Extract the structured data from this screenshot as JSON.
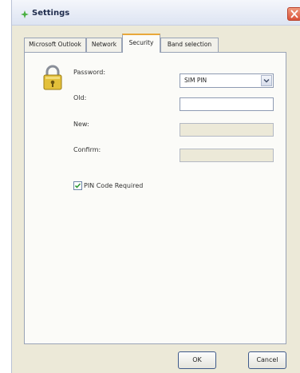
{
  "window": {
    "title": "Settings"
  },
  "tabs": [
    {
      "label": "Microsoft Outlook"
    },
    {
      "label": "Network"
    },
    {
      "label": "Security",
      "active": true
    },
    {
      "label": "Band selection"
    }
  ],
  "security": {
    "password_label": "Password:",
    "password_select_value": "SIM PIN",
    "old_label": "Old:",
    "old_value": "",
    "new_label": "New:",
    "confirm_label": "Confirm:",
    "pin_required_label": "PIN Code Required",
    "pin_required_checked": true
  },
  "buttons": {
    "ok": "OK",
    "cancel": "Cancel"
  },
  "colors": {
    "active_tab_accent": "#e9a83a",
    "close_button": "#d9533a",
    "title_icon": "#4ab043"
  },
  "icons": {
    "title": "settings-icon",
    "lock": "lock-icon",
    "close": "close-icon"
  }
}
